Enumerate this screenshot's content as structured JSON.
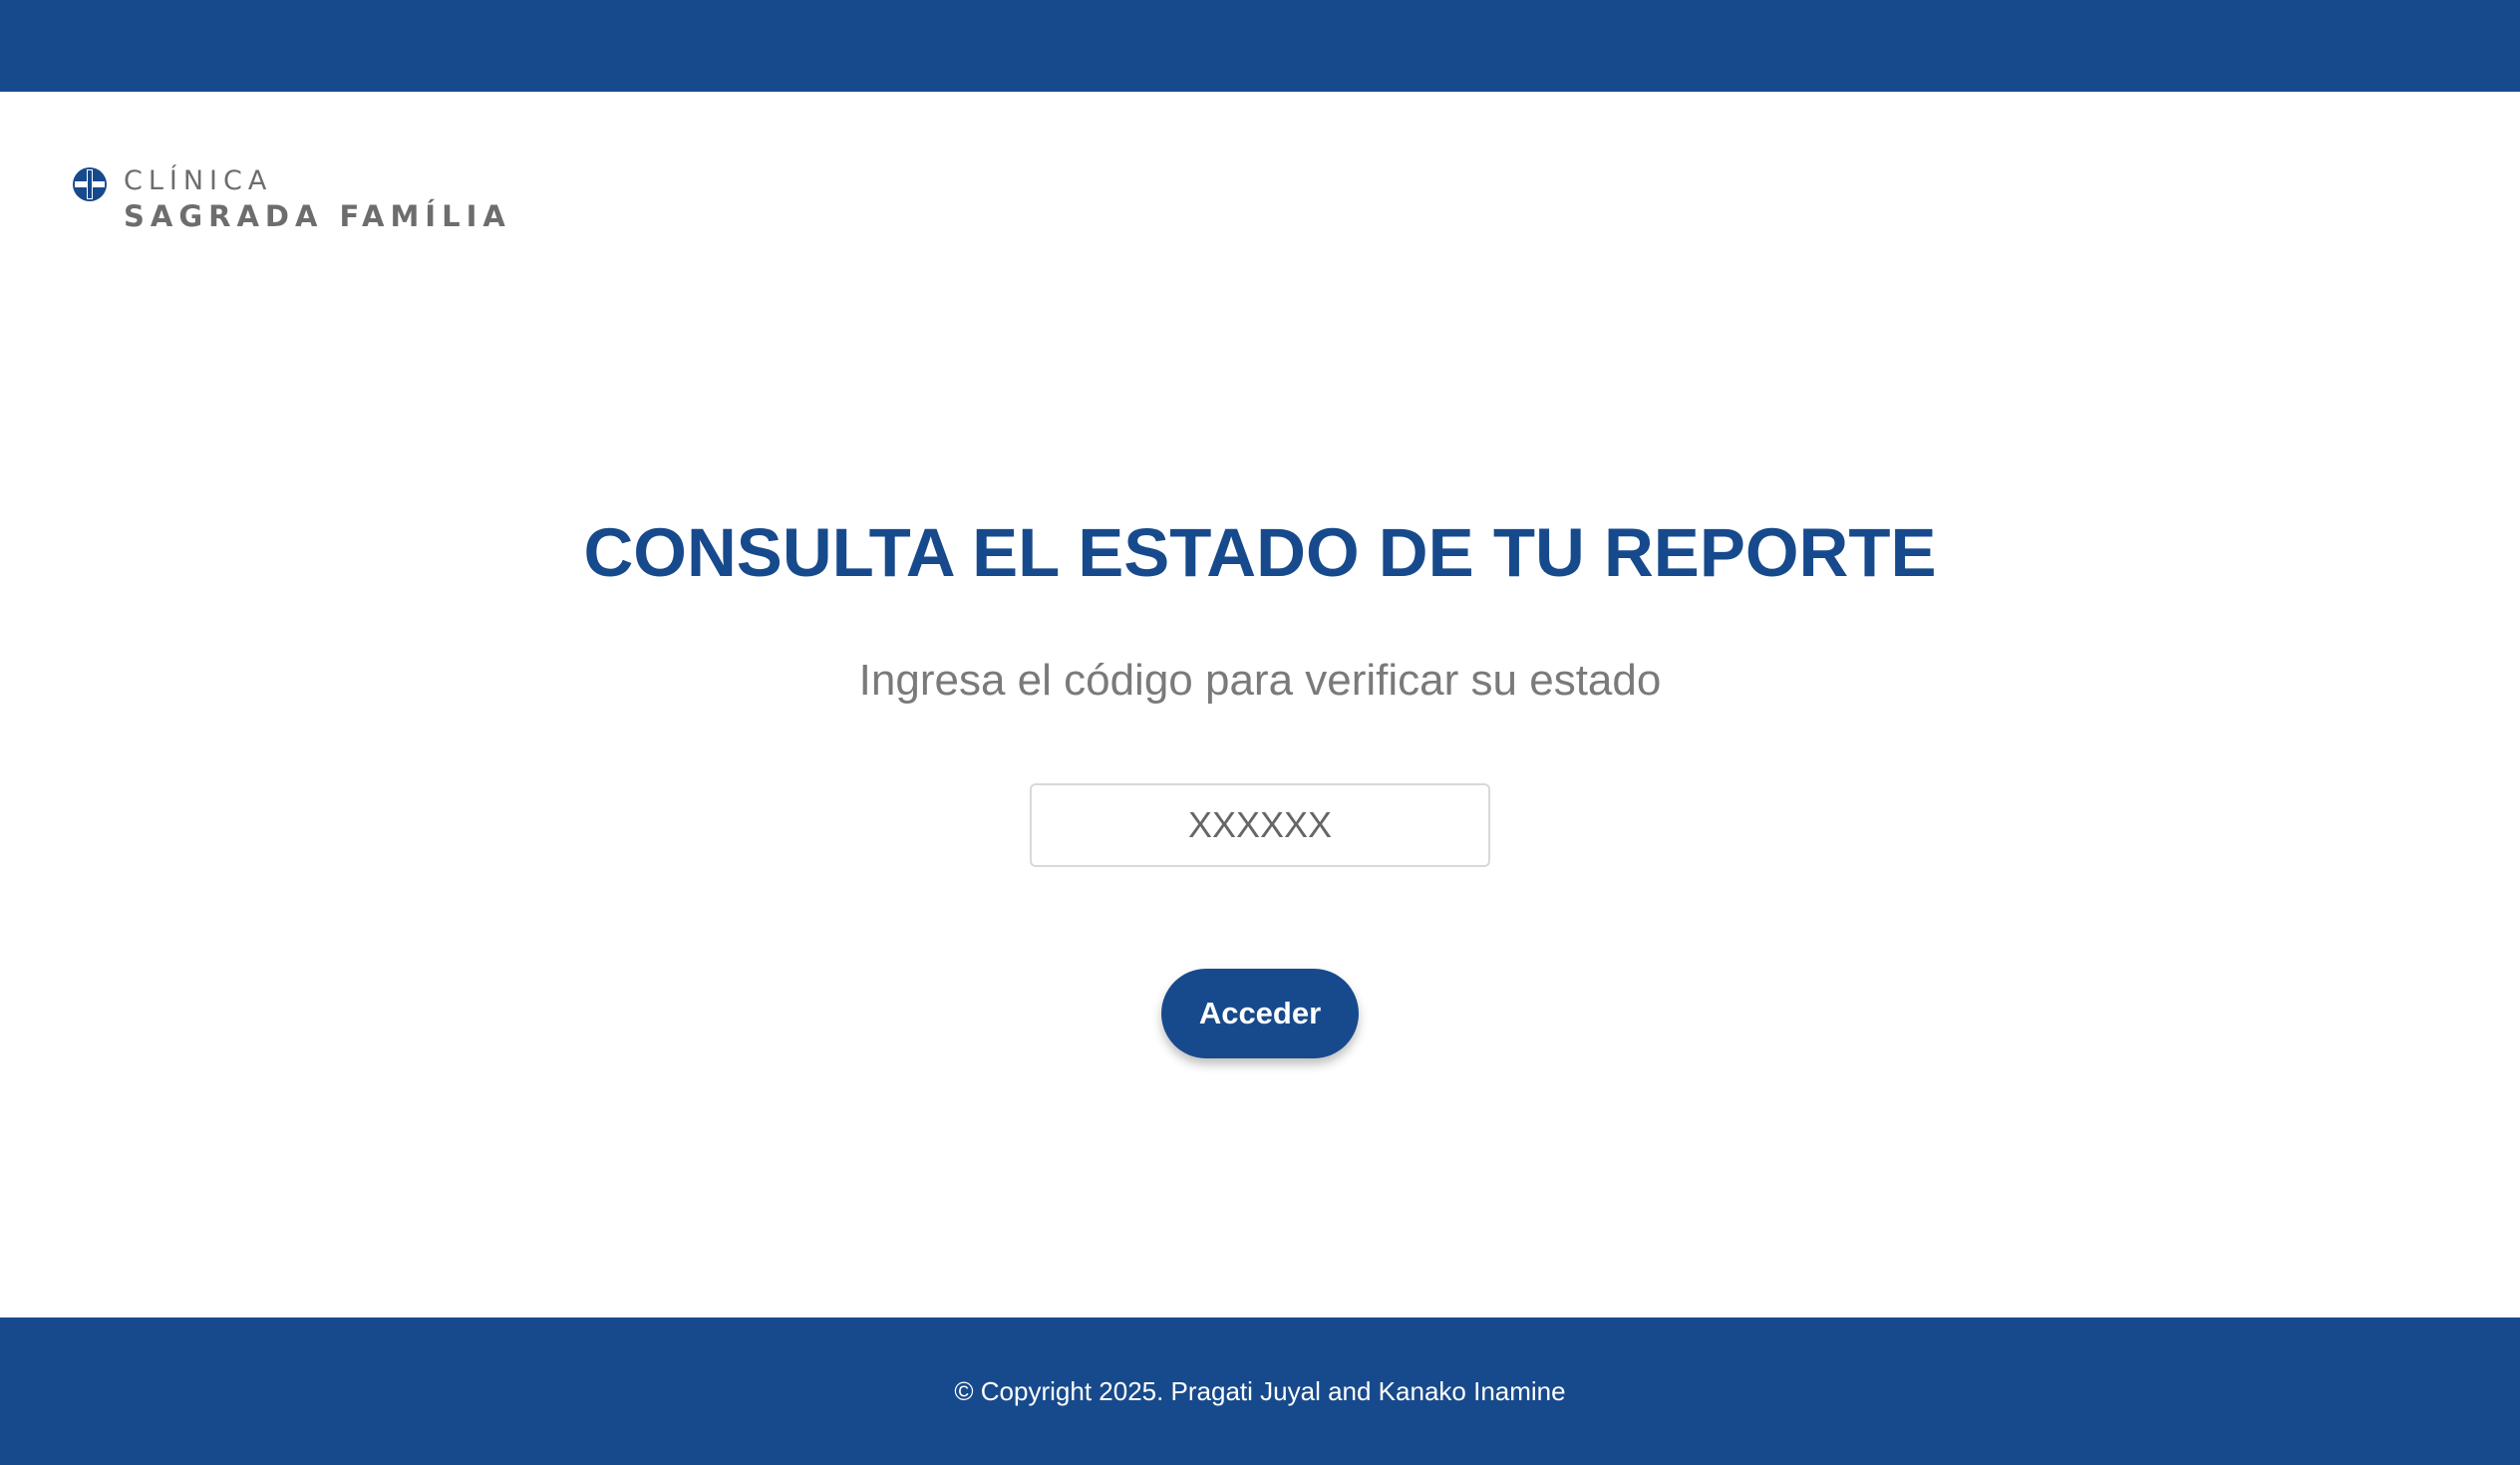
{
  "colors": {
    "brand": "#174a8c",
    "title": "#174a8c",
    "subtitle": "#7a7a7a",
    "logo_text": "#6d6d6d",
    "footer_text": "#ffffff"
  },
  "logo": {
    "icon": "clinic-cross-icon",
    "line1": "CLÍNICA",
    "line2": "SAGRADA FAMÍLIA"
  },
  "main": {
    "title": "CONSULTA EL ESTADO DE TU REPORTE",
    "subtitle": "Ingresa el código para verificar su estado",
    "code_input": {
      "placeholder": "XXXXXX",
      "value": ""
    },
    "submit_label": "Acceder"
  },
  "footer": {
    "copyright": "© Copyright 2025. Pragati Juyal and Kanako Inamine"
  }
}
